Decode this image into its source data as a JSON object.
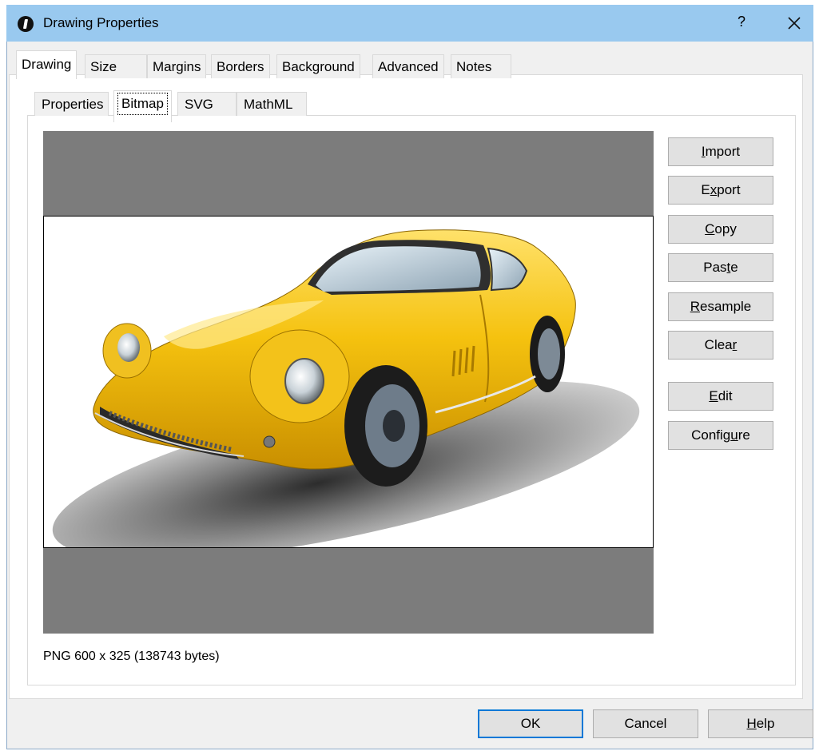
{
  "window": {
    "title": "Drawing Properties",
    "help_label": "?"
  },
  "outer_tabs": [
    "Drawing",
    "Size",
    "Margins",
    "Borders",
    "Background",
    "Advanced",
    "Notes"
  ],
  "outer_tabs_active": "Drawing",
  "inner_tabs": [
    "Properties",
    "Bitmap",
    "SVG",
    "MathML"
  ],
  "inner_tabs_active": "Bitmap",
  "side_buttons": [
    {
      "pre": "",
      "key": "I",
      "post": "mport"
    },
    {
      "pre": "E",
      "key": "x",
      "post": "port"
    },
    {
      "pre": "",
      "key": "C",
      "post": "opy"
    },
    {
      "pre": "Pas",
      "key": "t",
      "post": "e"
    },
    {
      "pre": "",
      "key": "R",
      "post": "esample"
    },
    {
      "pre": "Clea",
      "key": "r",
      "post": ""
    },
    {
      "pre": "",
      "key": "E",
      "post": "dit"
    },
    {
      "pre": "Config",
      "key": "u",
      "post": "re"
    }
  ],
  "image_info": "PNG 600 x 325 (138743 bytes)",
  "bottom_buttons": {
    "ok": "OK",
    "cancel": "Cancel",
    "help": {
      "pre": "",
      "key": "H",
      "post": "elp"
    }
  },
  "colors": {
    "titlebar": "#99c9ef",
    "car_body": "#f5c20f",
    "preview_background": "#7c7c7c",
    "default_button_border": "#0078d7"
  }
}
